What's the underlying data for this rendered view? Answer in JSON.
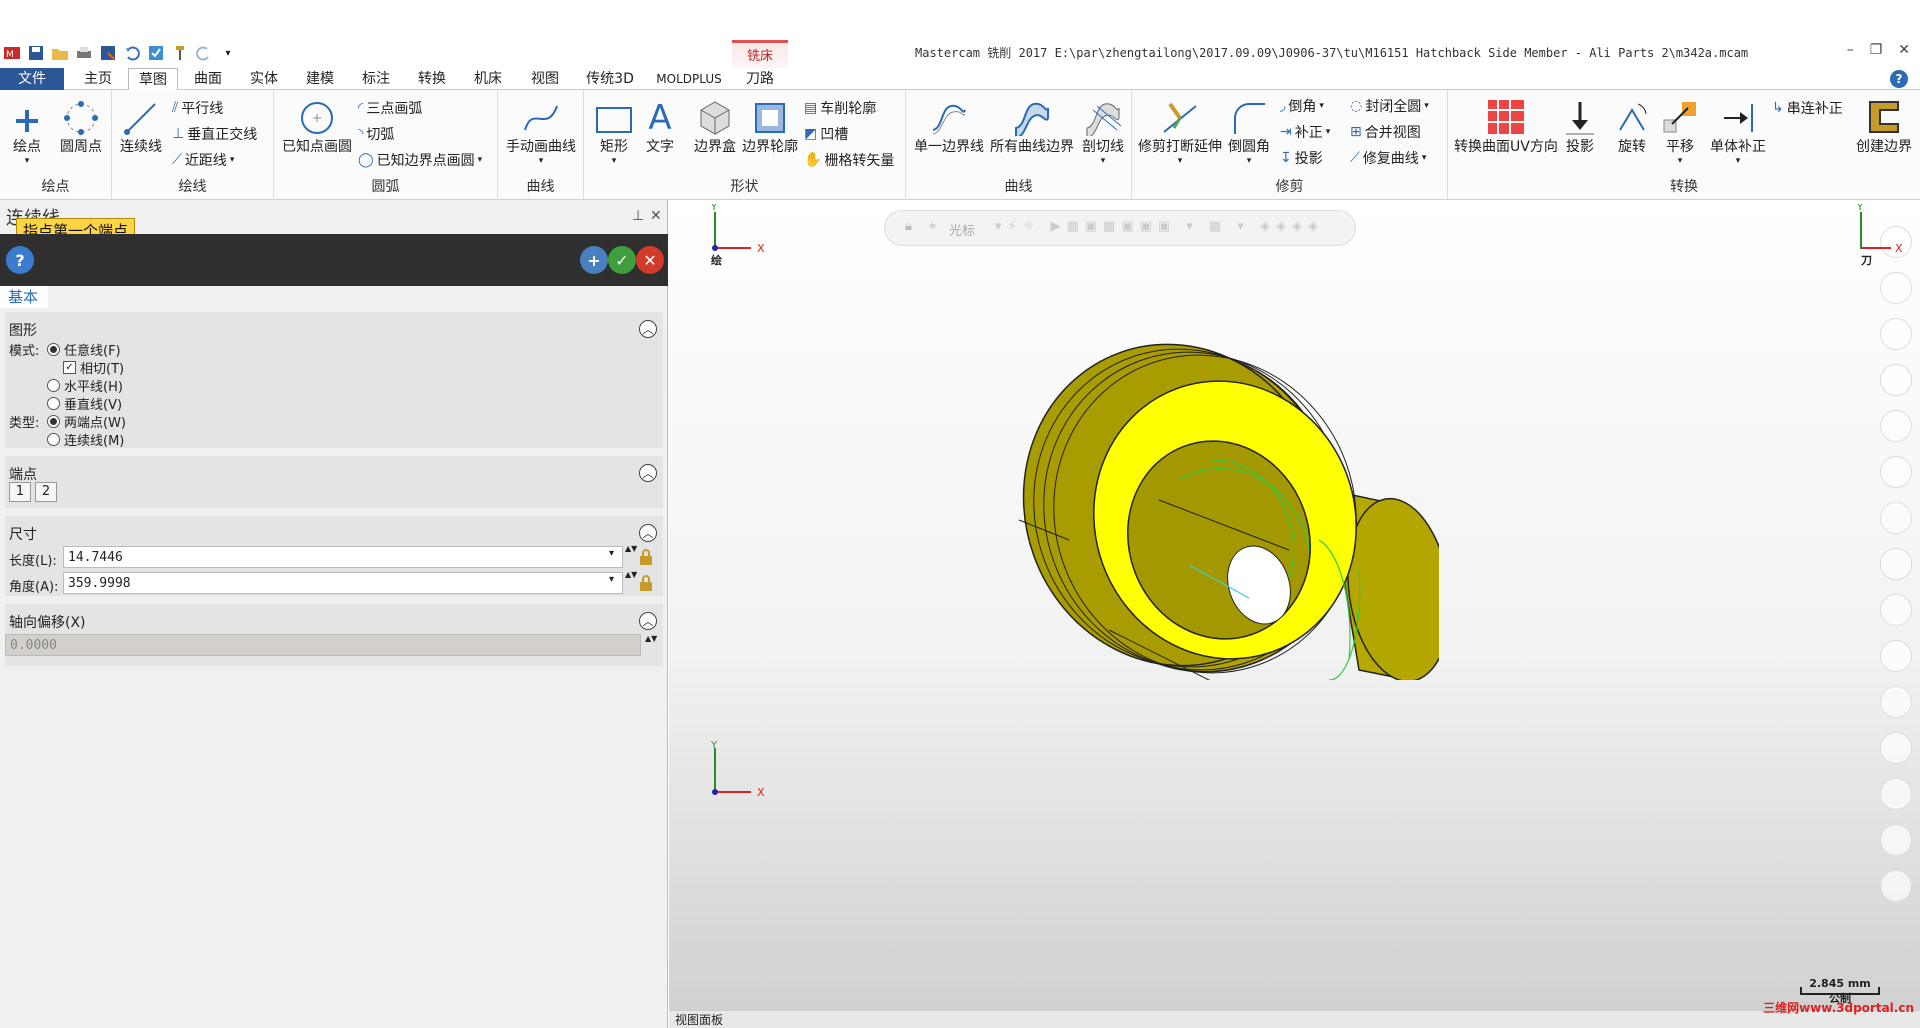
{
  "app": {
    "title": "Mastercam 铣削 2017  E:\\par\\zhengtailong\\2017.09.09\\J0906-37\\tu\\M16151 Hatchback Side Member - Ali Parts 2\\m342a.mcam",
    "context_tab_group": "铣床",
    "context_tab": "刀路"
  },
  "tabs": [
    "文件",
    "主页",
    "草图",
    "曲面",
    "实体",
    "建模",
    "标注",
    "转换",
    "机床",
    "视图",
    "传统3D",
    "MOLDPLUS"
  ],
  "ribbon": {
    "points": {
      "label": "绘点",
      "buttons": [
        "绘点",
        "圆周点"
      ]
    },
    "lines": {
      "label": "绘线",
      "big": "连续线",
      "small": [
        "平行线",
        "垂直正交线",
        "近距线"
      ]
    },
    "arcs": {
      "label": "圆弧",
      "big": "已知点画圆",
      "small": [
        "三点画弧",
        "切弧",
        "已知边界点画圆"
      ]
    },
    "curves1": {
      "label": "曲线",
      "big": "手动画曲线"
    },
    "shapes": {
      "label": "形状",
      "big": [
        "矩形",
        "文字",
        "边界盒",
        "边界轮廓"
      ],
      "small": [
        "车削轮廓",
        "凹槽",
        "栅格转矢量"
      ]
    },
    "curves2": {
      "label": "曲线",
      "big": [
        "单一边界线",
        "所有曲线边界",
        "剖切线"
      ]
    },
    "trim": {
      "label": "修剪",
      "big": [
        "修剪打断延伸",
        "倒圆角"
      ],
      "small": [
        "倒角",
        "补正",
        "投影",
        "封闭全圆",
        "合并视图",
        "修复曲线"
      ]
    },
    "transform": {
      "label": "转换",
      "big": [
        "转换曲面UV方向",
        "投影",
        "旋转",
        "平移",
        "单体补正",
        "创建边界"
      ],
      "small": [
        "串连补正"
      ]
    }
  },
  "panel": {
    "title": "连续线",
    "tooltip": "指点第一个端点",
    "tab": "基本",
    "graphics": {
      "header": "图形",
      "mode_label": "模式:",
      "modes": [
        "任意线(F)",
        "水平线(H)",
        "垂直线(V)"
      ],
      "tangent": "相切(T)",
      "type_label": "类型:",
      "types": [
        "两端点(W)",
        "连续线(M)"
      ]
    },
    "endpoints": {
      "header": "端点",
      "buttons": [
        "1",
        "2"
      ]
    },
    "size": {
      "header": "尺寸",
      "length_label": "长度(L):",
      "length": "14.7446",
      "angle_label": "角度(A):",
      "angle": "359.9998"
    },
    "axial": {
      "header": "轴向偏移(X)",
      "value": "0.0000"
    }
  },
  "viewport": {
    "tool_label": "光标",
    "scale_value": "2.845 mm",
    "scale_unit": "公制",
    "viewbar": "视图面板",
    "watermark": "三维网www.3dportal.cn",
    "gnomon_top_left": "绘",
    "gnomon_top_right": "刀"
  },
  "colors": {
    "file_tab": "#2b5797",
    "part": "#ffff00",
    "part_dark": "#b5a800",
    "accent": "#c02020"
  }
}
